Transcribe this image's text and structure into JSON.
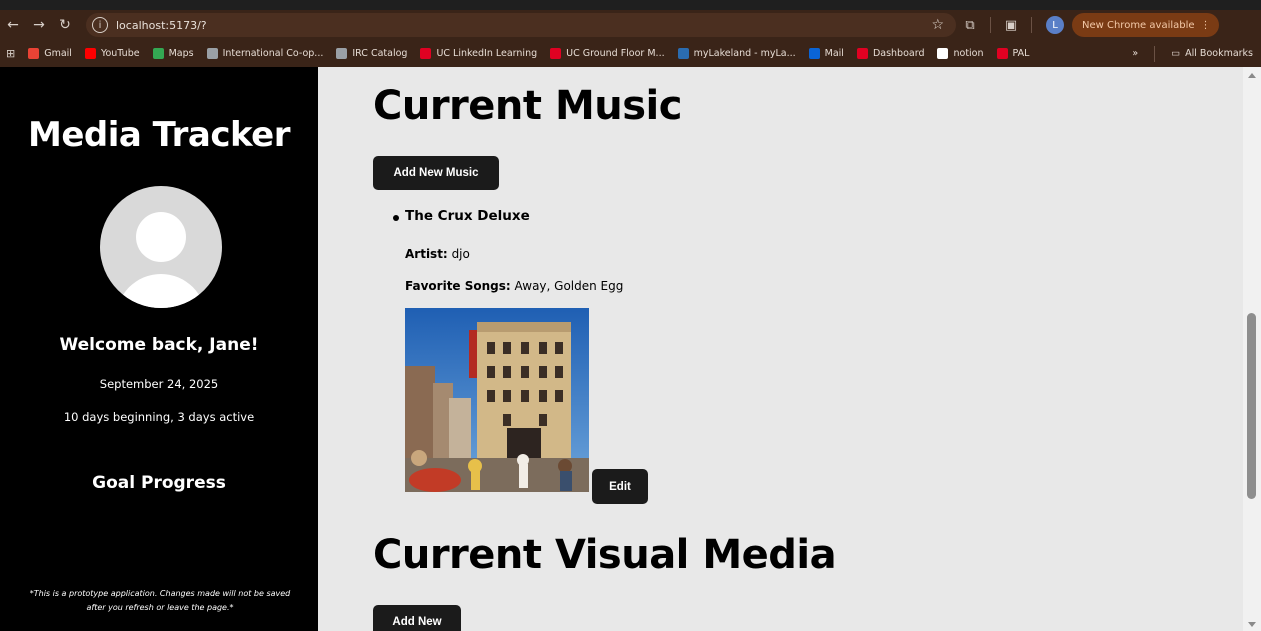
{
  "browser": {
    "url": "localhost:5173/?",
    "update_label": "New Chrome available",
    "profile_initial": "L",
    "bookmarks": [
      {
        "label": "Gmail",
        "icon": "gmail-icon",
        "color": "#ea4335"
      },
      {
        "label": "YouTube",
        "icon": "youtube-icon",
        "color": "#ff0000"
      },
      {
        "label": "Maps",
        "icon": "maps-icon",
        "color": "#34a853"
      },
      {
        "label": "International Co-op...",
        "icon": "globe-icon",
        "color": "#9aa0a6"
      },
      {
        "label": "IRC Catalog",
        "icon": "globe-icon",
        "color": "#9aa0a6"
      },
      {
        "label": "UC LinkedIn Learning",
        "icon": "uc-icon",
        "color": "#e00122"
      },
      {
        "label": "UC Ground Floor M...",
        "icon": "uc-icon",
        "color": "#e00122"
      },
      {
        "label": "myLakeland - myLa...",
        "icon": "lakeland-icon",
        "color": "#2b6cb0"
      },
      {
        "label": "Mail",
        "icon": "outlook-icon",
        "color": "#0a64d6"
      },
      {
        "label": "Dashboard",
        "icon": "uc-icon",
        "color": "#e00122"
      },
      {
        "label": "notion",
        "icon": "notion-icon",
        "color": "#ffffff"
      },
      {
        "label": "PAL",
        "icon": "uc-icon",
        "color": "#e00122"
      }
    ],
    "overflow_label": "»",
    "all_bookmarks_label": "All Bookmarks"
  },
  "sidebar": {
    "app_title": "Media Tracker",
    "welcome": "Welcome back, Jane!",
    "date": "September 24, 2025",
    "streak": "10 days beginning, 3 days active",
    "goal_heading": "Goal Progress",
    "disclaimer": "*This is a prototype application. Changes made will not be saved after you refresh or leave the page.*"
  },
  "music": {
    "heading": "Current Music",
    "add_button": "Add New Music",
    "items": [
      {
        "title": "The Crux Deluxe",
        "artist_label": "Artist:",
        "artist": "djo",
        "favorites_label": "Favorite Songs:",
        "favorites": "Away, Golden Egg",
        "edit_label": "Edit"
      }
    ]
  },
  "visual": {
    "heading": "Current Visual Media",
    "add_button": "Add New"
  }
}
